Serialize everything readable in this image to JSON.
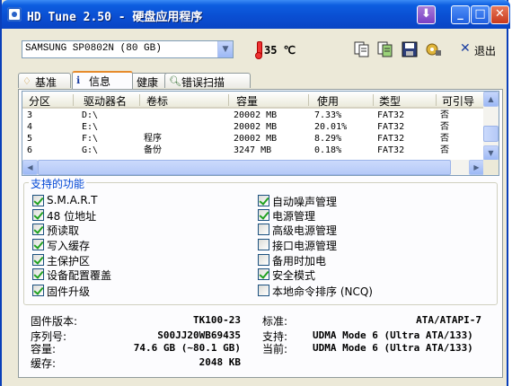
{
  "window": {
    "title": "HD Tune 2.50 - 硬盘应用程序"
  },
  "toolbar": {
    "drive": "SAMSUNG SP0802N (80 GB)",
    "temperature": "35 ℃",
    "exit_label": "退出",
    "icons": [
      "copy-icon",
      "copy-all-icon",
      "save-icon",
      "options-icon"
    ]
  },
  "tabs": [
    {
      "label": "基准",
      "active": false
    },
    {
      "label": "信息",
      "active": true
    },
    {
      "label": "健康",
      "active": false
    },
    {
      "label": "错误扫描",
      "active": false
    }
  ],
  "partitions": {
    "headers": [
      "分区",
      "驱动器名",
      "卷标",
      "容量",
      "使用",
      "类型",
      "可引导"
    ],
    "rows": [
      [
        "3",
        "D:\\",
        "",
        "20002 MB",
        "7.33%",
        "FAT32",
        "否"
      ],
      [
        "4",
        "E:\\",
        "",
        "20002 MB",
        "20.01%",
        "FAT32",
        "否"
      ],
      [
        "5",
        "F:\\",
        "程序",
        "20002 MB",
        "8.29%",
        "FAT32",
        "否"
      ],
      [
        "6",
        "G:\\",
        "备份",
        "3247 MB",
        "0.18%",
        "FAT32",
        "否"
      ]
    ]
  },
  "features": {
    "title": "支持的功能",
    "left": [
      {
        "label": "S.M.A.R.T",
        "checked": true
      },
      {
        "label": "48 位地址",
        "checked": true
      },
      {
        "label": "预读取",
        "checked": true
      },
      {
        "label": "写入缓存",
        "checked": true
      },
      {
        "label": "主保护区",
        "checked": true
      },
      {
        "label": "设备配置覆盖",
        "checked": true
      },
      {
        "label": "固件升级",
        "checked": true
      }
    ],
    "right": [
      {
        "label": "自动噪声管理",
        "checked": true
      },
      {
        "label": "电源管理",
        "checked": true
      },
      {
        "label": "高级电源管理",
        "checked": false
      },
      {
        "label": "接口电源管理",
        "checked": false
      },
      {
        "label": "备用时加电",
        "checked": false
      },
      {
        "label": "安全模式",
        "checked": true
      },
      {
        "label": "本地命令排序 (NCQ)",
        "checked": false
      }
    ]
  },
  "info": {
    "firmware_label": "固件版本:",
    "firmware": "TK100-23",
    "serial_label": "序列号:",
    "serial": "S00JJ20WB69435",
    "capacity_label": "容量:",
    "capacity": "74.6 GB (~80.1 GB)",
    "cache_label": "缓存:",
    "cache": "2048 KB",
    "standard_label": "标准:",
    "standard": "ATA/ATAPI-7",
    "support_label": "支持:",
    "support": "UDMA Mode 6 (Ultra ATA/133)",
    "current_label": "当前:",
    "current": "UDMA Mode 6 (Ultra ATA/133)"
  }
}
